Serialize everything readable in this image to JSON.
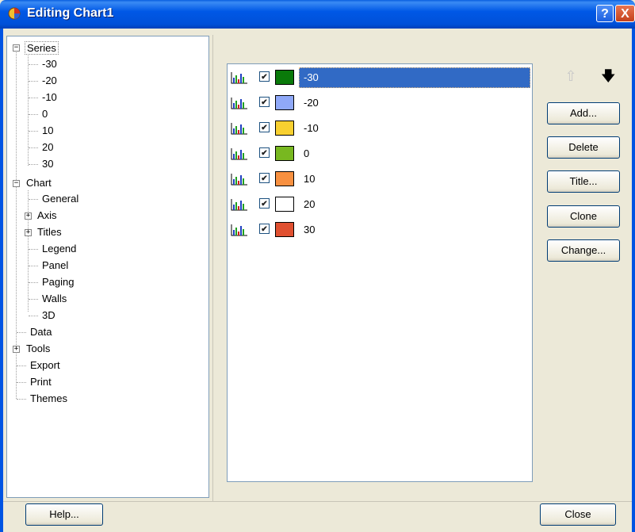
{
  "window": {
    "title": "Editing Chart1",
    "help_glyph": "?",
    "close_glyph": "X"
  },
  "tree": {
    "series_label": "Series",
    "series_items": [
      "-30",
      "-20",
      "-10",
      "0",
      "10",
      "20",
      "30"
    ],
    "chart_label": "Chart",
    "chart_items": [
      "General",
      "Axis",
      "Titles",
      "Legend",
      "Panel",
      "Paging",
      "Walls",
      "3D"
    ],
    "root_items": [
      "Data",
      "Tools",
      "Export",
      "Print",
      "Themes"
    ]
  },
  "series_list": [
    {
      "label": "-30",
      "color": "#0a7a0a",
      "checked": true,
      "selected": true
    },
    {
      "label": "-20",
      "color": "#8fa8f8",
      "checked": true,
      "selected": false
    },
    {
      "label": "-10",
      "color": "#f8d030",
      "checked": true,
      "selected": false
    },
    {
      "label": "0",
      "color": "#78b820",
      "checked": true,
      "selected": false
    },
    {
      "label": "10",
      "color": "#f89040",
      "checked": true,
      "selected": false
    },
    {
      "label": "20",
      "color": "#ffffff",
      "checked": true,
      "selected": false
    },
    {
      "label": "30",
      "color": "#e05030",
      "checked": true,
      "selected": false
    }
  ],
  "buttons": {
    "add": "Add...",
    "delete": "Delete",
    "title": "Title...",
    "clone": "Clone",
    "change": "Change...",
    "help": "Help...",
    "close": "Close"
  },
  "icons": {
    "move_up": "arrow-up-icon",
    "move_down": "arrow-down-icon",
    "series_type": "bar-chart-icon"
  },
  "colors": {
    "titlebar": "#0054e3",
    "selection": "#316ac5",
    "dialog_bg": "#ece9d8"
  }
}
